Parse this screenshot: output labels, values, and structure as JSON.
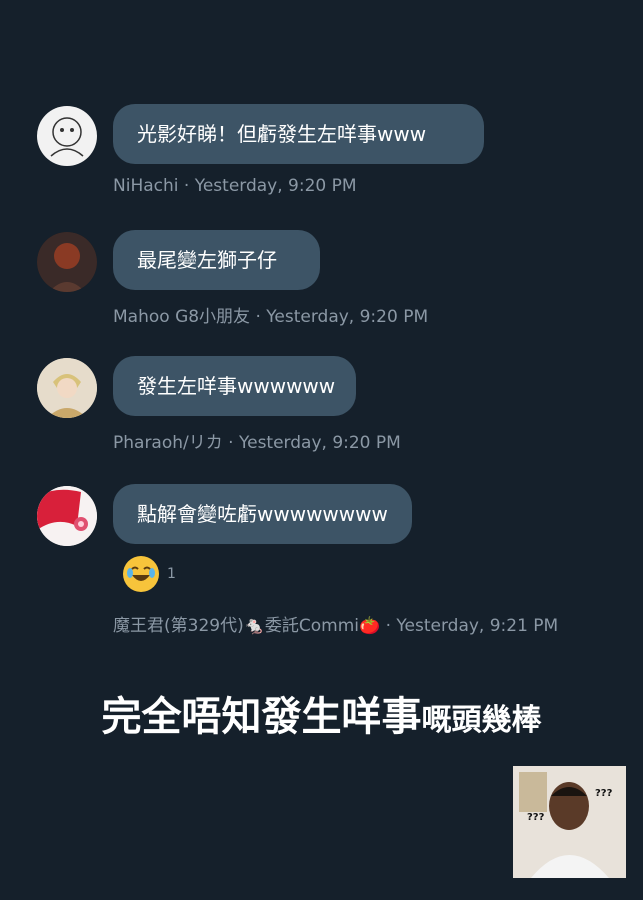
{
  "messages": [
    {
      "text": "光影好睇！但虧發生左咩事www",
      "author": "NiHachi",
      "sep": " · ",
      "time": "Yesterday, 9:20 PM"
    },
    {
      "text": "最尾變左獅子仔",
      "author": "Mahoo G8小朋友",
      "sep": " · ",
      "time": "Yesterday, 9:20 PM"
    },
    {
      "text": "發生左咩事wwwwww",
      "author": "Pharaoh/リカ",
      "sep": " · ",
      "time": "Yesterday, 9:20 PM"
    },
    {
      "text": "點解會變咗虧wwwwwwww",
      "author": "魔王君(第329代)🐁委託Commi🍅",
      "sep": " · ",
      "time": "Yesterday, 9:21 PM"
    }
  ],
  "reaction": {
    "emoji": "joy-face",
    "count": "1"
  },
  "caption": {
    "main": "完全唔知發生咩事",
    "suffix": "嘅頭幾棒"
  },
  "meme": {
    "left_marks": "???",
    "right_marks": "???"
  }
}
